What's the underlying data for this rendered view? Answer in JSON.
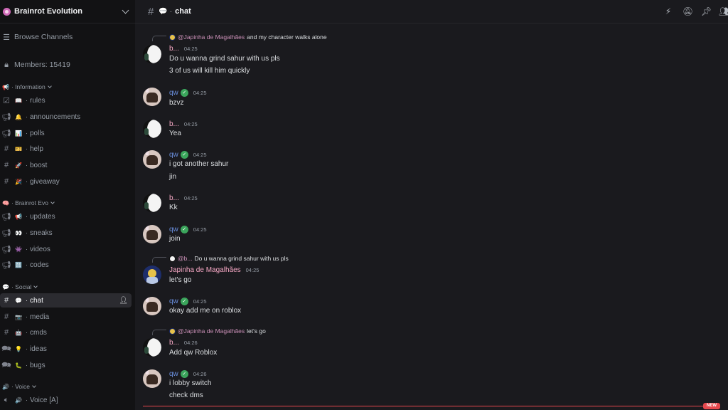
{
  "server": {
    "name": "Brainrot Evolution"
  },
  "sidebar": {
    "browse_channels": "Browse Channels",
    "members": "Members: 15419",
    "categories": [
      {
        "emoji": "📢",
        "label": "Information"
      },
      {
        "emoji": "🧠",
        "label": "Brainrot Evo"
      },
      {
        "emoji": "💬",
        "label": "Social"
      },
      {
        "emoji": "🔊",
        "label": "Voice"
      }
    ],
    "channels": [
      {
        "type": "rules-icon",
        "emoji": "📖",
        "name": "rules"
      },
      {
        "type": "megaphone-icon",
        "emoji": "🔔",
        "name": "announcements"
      },
      {
        "type": "megaphone-icon",
        "emoji": "📊",
        "name": "polls"
      },
      {
        "type": "hash-icon",
        "emoji": "🎫",
        "name": "help"
      },
      {
        "type": "hash-icon",
        "emoji": "🚀",
        "name": "boost"
      },
      {
        "type": "hash-icon",
        "emoji": "🎉",
        "name": "giveaway"
      },
      {
        "type": "megaphone-icon",
        "emoji": "📢",
        "name": "updates"
      },
      {
        "type": "megaphone-icon",
        "emoji": "👀",
        "name": "sneaks"
      },
      {
        "type": "megaphone-icon",
        "emoji": "👾",
        "name": "videos"
      },
      {
        "type": "megaphone-icon",
        "emoji": "🔠",
        "name": "codes"
      },
      {
        "type": "hash-icon",
        "emoji": "💬",
        "name": "chat"
      },
      {
        "type": "hash-icon",
        "emoji": "📷",
        "name": "media"
      },
      {
        "type": "hash-icon",
        "emoji": "🤖",
        "name": "cmds"
      },
      {
        "type": "forum-icon",
        "emoji": "💡",
        "name": "ideas"
      },
      {
        "type": "forum-icon",
        "emoji": "🐛",
        "name": "bugs"
      },
      {
        "type": "speaker-icon",
        "emoji": "🔊",
        "name": "Voice [A]"
      }
    ]
  },
  "topbar": {
    "channel": "chat"
  },
  "messages": [
    {
      "reply_to": "@Japinha de Magalhães",
      "reply_text": "and my character walks alone",
      "author": "b...",
      "time": "04:25",
      "lines": [
        "Do u wanna grind sahur with us pls",
        "3 of us will kill him quickly"
      ]
    },
    {
      "author": "qw",
      "time": "04:25",
      "lines": [
        "bzvz"
      ]
    },
    {
      "author": "b...",
      "time": "04:25",
      "lines": [
        "Yea"
      ]
    },
    {
      "author": "qw",
      "time": "04:25",
      "lines": [
        "i got another sahur",
        "jin"
      ]
    },
    {
      "author": "b...",
      "time": "04:25",
      "lines": [
        "Kk"
      ]
    },
    {
      "author": "qw",
      "time": "04:25",
      "lines": [
        "join"
      ]
    },
    {
      "reply_to": "@b...",
      "reply_text": "Do u wanna grind sahur with us pls",
      "author": "Japinha de Magalhães",
      "time": "04:25",
      "lines": [
        "let's go"
      ]
    },
    {
      "author": "qw",
      "time": "04:25",
      "lines": [
        "okay add me on roblox"
      ]
    },
    {
      "reply_to": "@Japinha de Magalhães",
      "reply_text": "let's go",
      "author": "b...",
      "time": "04:26",
      "lines": [
        "Add qw Roblox"
      ]
    },
    {
      "author": "qw",
      "time": "04:26",
      "lines": [
        "i lobby switch",
        "check dms"
      ]
    }
  ],
  "new_label": "NEW"
}
